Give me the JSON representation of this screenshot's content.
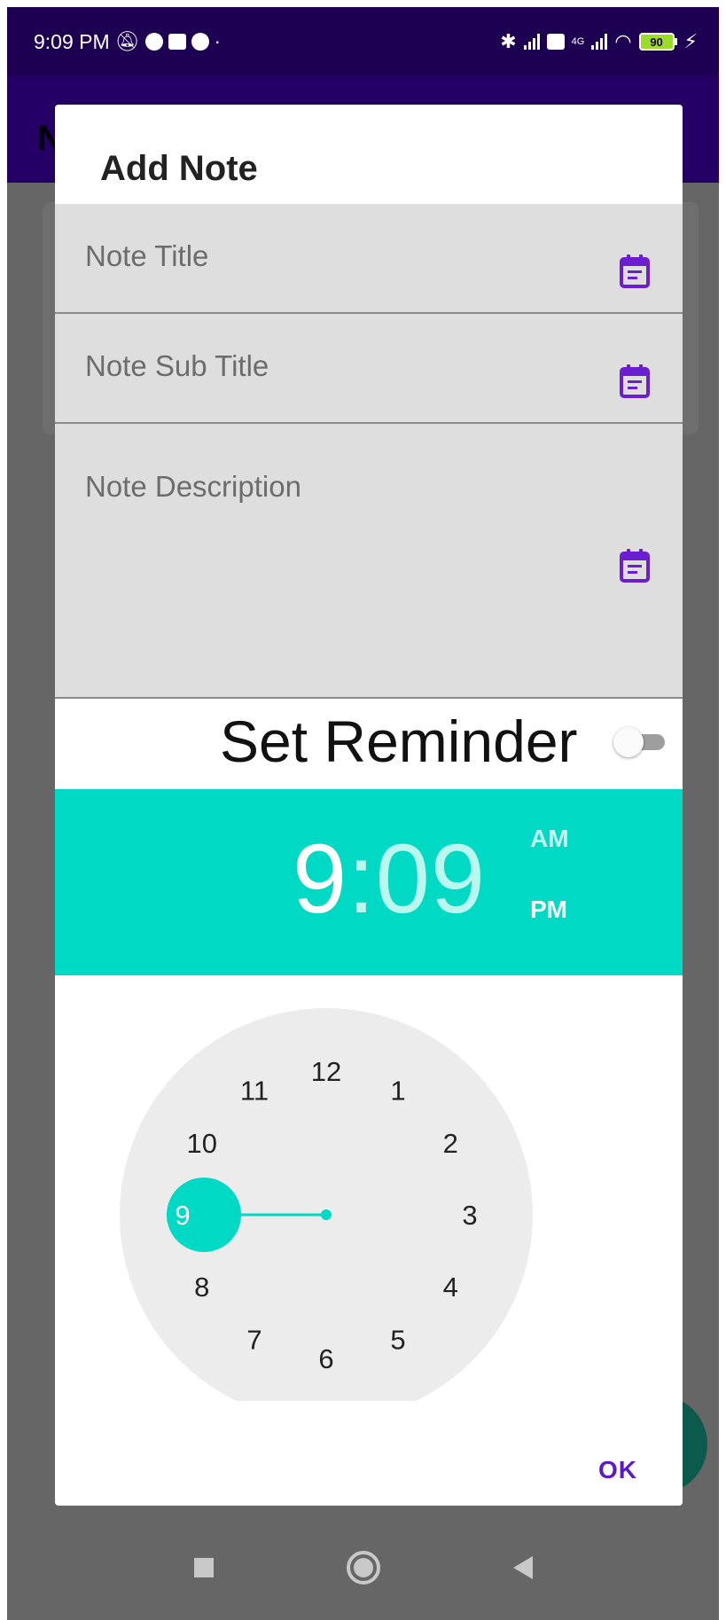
{
  "status_bar": {
    "time": "9:09 PM",
    "signal_label": "4G",
    "battery_level": "90"
  },
  "app_bar": {
    "title_fragment": "N"
  },
  "dialog": {
    "title": "Add Note",
    "fields": {
      "title_placeholder": "Note Title",
      "subtitle_placeholder": "Note Sub Title",
      "description_placeholder": "Note Description"
    },
    "reminder": {
      "label": "Set Reminder",
      "enabled": false
    },
    "time_picker": {
      "hour": "9",
      "separator": ":",
      "minute": "09",
      "am_label": "AM",
      "pm_label": "PM",
      "selected_period": "PM",
      "clock_numbers": [
        "12",
        "1",
        "2",
        "3",
        "4",
        "5",
        "6",
        "7",
        "8",
        "9",
        "10",
        "11"
      ],
      "selected_hour": "9"
    },
    "ok_label": "OK"
  },
  "colors": {
    "status_bar": "#1e0053",
    "app_bar": "#240066",
    "accent_teal": "#00d9c4",
    "accent_purple": "#5d18c9",
    "field_background": "#dedede",
    "scrim": "#666666"
  }
}
